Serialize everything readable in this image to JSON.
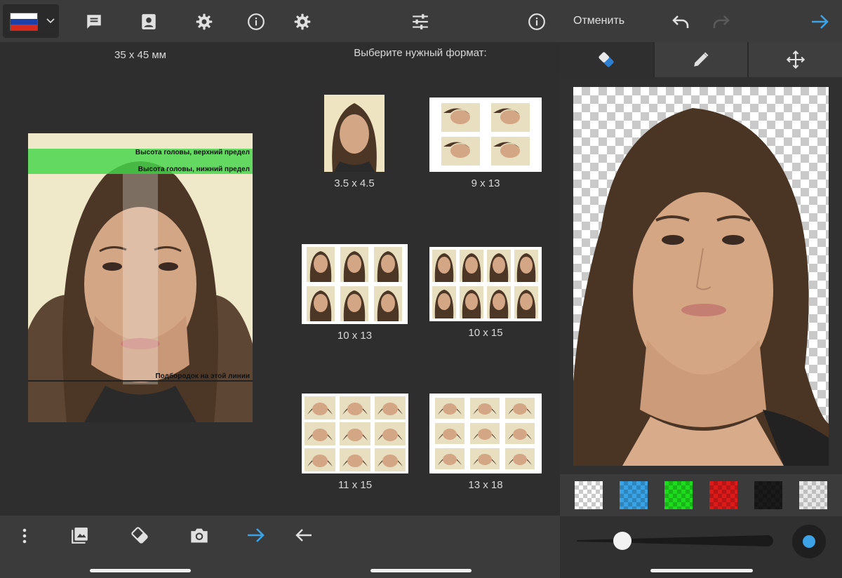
{
  "left": {
    "language_flag": "russia-flag",
    "format_label": "35 x 45 мм",
    "guides": {
      "top": "Высота головы, верхний предел",
      "bottom": "Высота головы, нижний предел",
      "chin": "Подбородок на этой линии"
    }
  },
  "middle": {
    "heading": "Выберите нужный формат:",
    "formats": [
      "3.5 x 4.5",
      "9 x 13",
      "10 x 13",
      "10 x 15",
      "11 x 15",
      "13 x 18"
    ]
  },
  "right": {
    "cancel_label": "Отменить",
    "swatch_colors": [
      "#9e9e9e",
      "#39a3e6",
      "#1ddc1d",
      "#dd1a1a",
      "#1a1a1a",
      "#e8e8e8"
    ],
    "accent": "#3ba3e6",
    "brush_size": 0.2
  }
}
